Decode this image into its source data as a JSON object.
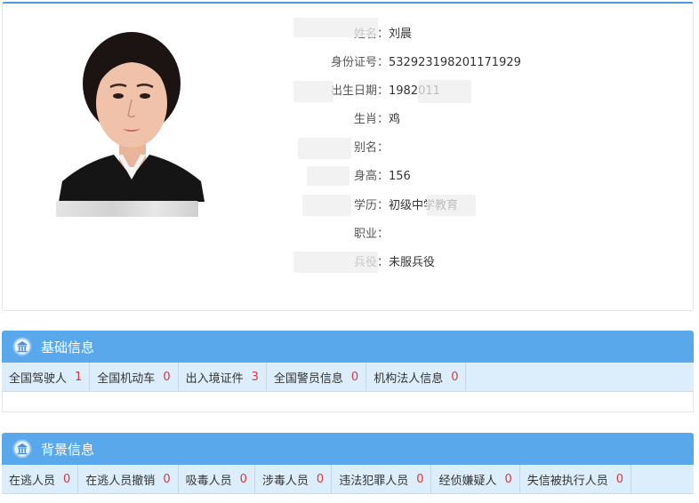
{
  "profile": {
    "fields": [
      {
        "label": "姓名",
        "value": "刘晨"
      },
      {
        "label": "身份证号",
        "value": "532923198201171929"
      },
      {
        "label": "出生日期",
        "value": "1982011"
      },
      {
        "label": "生肖",
        "value": "鸡"
      },
      {
        "label": "别名",
        "value": ""
      },
      {
        "label": "身高",
        "value": "156"
      },
      {
        "label": "学历",
        "value": "初级中学教育"
      },
      {
        "label": "职业",
        "value": ""
      },
      {
        "label": "兵役",
        "value": "未服兵役"
      }
    ]
  },
  "basic_info": {
    "title": "基础信息",
    "icon": "building-icon",
    "tabs": [
      {
        "label": "全国驾驶人",
        "count": "1"
      },
      {
        "label": "全国机动车",
        "count": "0"
      },
      {
        "label": "出入境证件",
        "count": "3"
      },
      {
        "label": "全国警员信息",
        "count": "0"
      },
      {
        "label": "机构法人信息",
        "count": "0"
      }
    ]
  },
  "background_info": {
    "title": "背景信息",
    "icon": "building-icon",
    "tabs": [
      {
        "label": "在逃人员",
        "count": "0"
      },
      {
        "label": "在逃人员撤销",
        "count": "0"
      },
      {
        "label": "吸毒人员",
        "count": "0"
      },
      {
        "label": "涉毒人员",
        "count": "0"
      },
      {
        "label": "违法犯罪人员",
        "count": "0"
      },
      {
        "label": "经侦嫌疑人",
        "count": "0"
      },
      {
        "label": "失信被执行人员",
        "count": "0"
      }
    ]
  },
  "colors": {
    "accent": "#5aa8ec",
    "tab_bg": "#dceefb",
    "count": "#d9363e"
  }
}
